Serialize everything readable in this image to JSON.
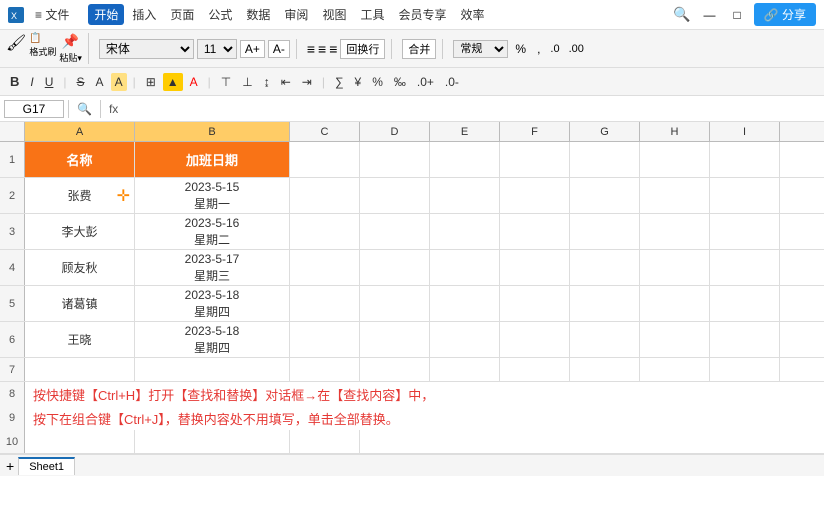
{
  "titlebar": {
    "menu_items": [
      "文件",
      "开始",
      "插入",
      "页面",
      "公式",
      "数据",
      "审阅",
      "视图",
      "工具",
      "会员专享",
      "效率"
    ],
    "active_tab": "开始",
    "share_label": "分享"
  },
  "ribbon": {
    "font_name": "宋体",
    "font_size": "11",
    "wrap_label": "回换行",
    "merge_label": "合并",
    "format_label": "常规",
    "bold": "B",
    "italic": "I",
    "underline": "U"
  },
  "formula_bar": {
    "cell_ref": "G17",
    "formula_placeholder": "fx"
  },
  "columns": {
    "headers": [
      "A",
      "B",
      "C",
      "D",
      "E",
      "F",
      "G",
      "H",
      "I"
    ]
  },
  "rows": [
    {
      "row_num": "1",
      "col_a": "名称",
      "col_b": "加班日期",
      "header": true
    },
    {
      "row_num": "2",
      "col_a": "张费",
      "date": "2023-5-15",
      "weekday": "星期一"
    },
    {
      "row_num": "3",
      "col_a": "李大彭",
      "date": "2023-5-16",
      "weekday": "星期二"
    },
    {
      "row_num": "4",
      "col_a": "顾友秋",
      "date": "2023-5-17",
      "weekday": "星期三"
    },
    {
      "row_num": "5",
      "col_a": "诸葛镇",
      "date": "2023-5-18",
      "weekday": "星期四"
    },
    {
      "row_num": "6",
      "col_a": "王晓",
      "date": "2023-5-18",
      "weekday": "星期四"
    }
  ],
  "empty_rows": [
    "7",
    "8",
    "9",
    "10"
  ],
  "instruction": {
    "line1": "按快捷键【Ctrl+H】打开【查找和替换】对话框→在【查找内容】中，",
    "line2": "按下在组合键【Ctrl+J】，替换内容处不用填写，单击全部替换。"
  },
  "sheet_tab": "Sheet1"
}
